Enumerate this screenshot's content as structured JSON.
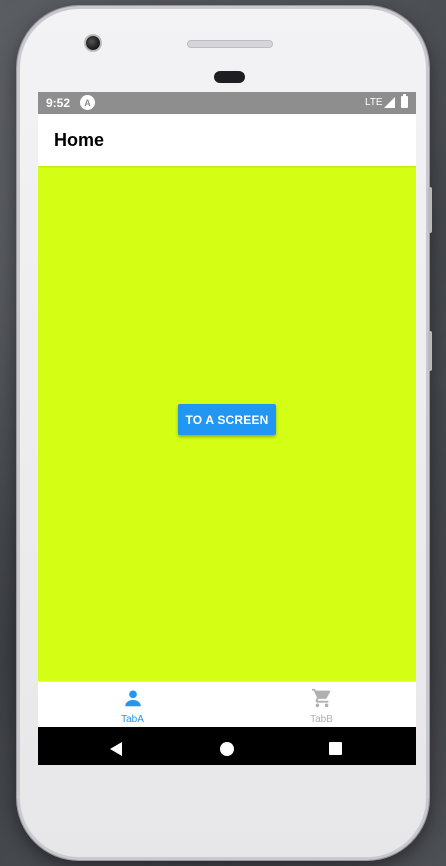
{
  "status_bar": {
    "time": "9:52",
    "app_badge": "A",
    "network": "LTE"
  },
  "header": {
    "title": "Home"
  },
  "content": {
    "background": "#d4ff15",
    "button_label": "TO A SCREEN",
    "button_color": "#2196f3"
  },
  "tabs": [
    {
      "label": "TabA",
      "icon": "person-icon",
      "active": true,
      "color": "#2196f3"
    },
    {
      "label": "TabB",
      "icon": "cart-icon",
      "active": false,
      "color": "#b0b0b0"
    }
  ],
  "nav_bar": {
    "back_icon": "back-triangle-icon",
    "home_icon": "home-circle-icon",
    "recents_icon": "recents-square-icon"
  }
}
